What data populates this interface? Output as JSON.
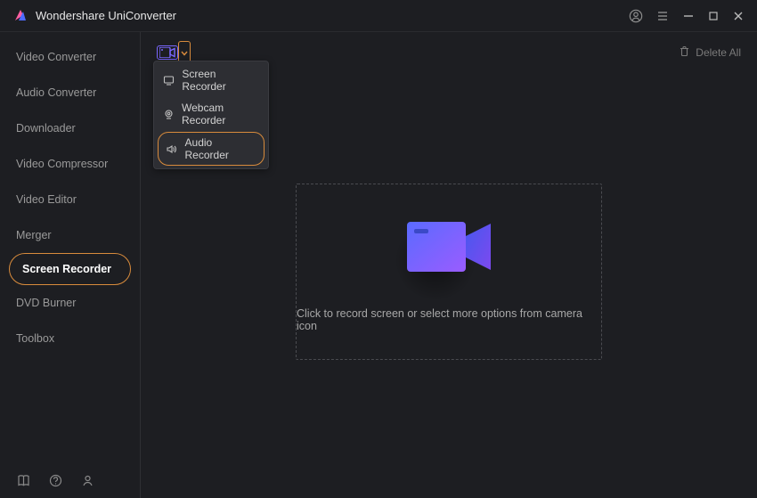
{
  "app": {
    "title": "Wondershare UniConverter"
  },
  "titlebar": {
    "deleteAll": "Delete All"
  },
  "sidebar": {
    "items": [
      {
        "label": "Video Converter"
      },
      {
        "label": "Audio Converter"
      },
      {
        "label": "Downloader"
      },
      {
        "label": "Video Compressor"
      },
      {
        "label": "Video Editor"
      },
      {
        "label": "Merger"
      },
      {
        "label": "Screen Recorder"
      },
      {
        "label": "DVD Burner"
      },
      {
        "label": "Toolbox"
      }
    ]
  },
  "recMenu": {
    "items": [
      {
        "label": "Screen Recorder"
      },
      {
        "label": "Webcam Recorder"
      },
      {
        "label": "Audio Recorder"
      }
    ]
  },
  "dropArea": {
    "text": "Click to record screen or select more options from camera icon"
  }
}
